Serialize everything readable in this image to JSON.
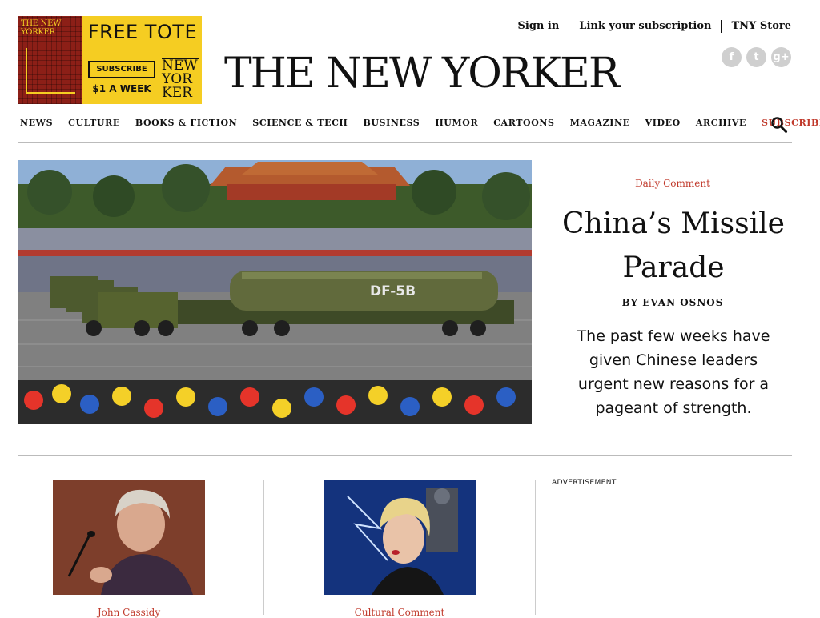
{
  "ad": {
    "cover_title": "THE NEW YORKER",
    "headline": "FREE TOTE",
    "subscribe_label": "SUBSCRIBE",
    "price": "$1 A WEEK",
    "tote_lines": [
      "NEW",
      "YOR",
      "KER"
    ]
  },
  "top_links": [
    "Sign in",
    "Link your subscription",
    "TNY Store"
  ],
  "social": [
    {
      "icon": "facebook-icon",
      "glyph": "f"
    },
    {
      "icon": "twitter-icon",
      "glyph": "t"
    },
    {
      "icon": "google-plus-icon",
      "glyph": "g+"
    }
  ],
  "logo": "THE NEW YORKER",
  "nav": [
    "NEWS",
    "CULTURE",
    "BOOKS & FICTION",
    "SCIENCE & TECH",
    "BUSINESS",
    "HUMOR",
    "CARTOONS",
    "MAGAZINE",
    "VIDEO",
    "ARCHIVE",
    "SUBSCRIBE"
  ],
  "colors": {
    "accent": "#c0392b"
  },
  "hero": {
    "kicker": "Daily Comment",
    "title": "China’s Missile Parade",
    "byline": "BY EVAN OSNOS",
    "dek": "The past few weeks have given Chinese leaders urgent new reasons for a pageant of strength.",
    "image_label": "DF-5B"
  },
  "cards": [
    {
      "kicker": "John Cassidy"
    },
    {
      "kicker": "Cultural Comment"
    }
  ],
  "advertisement_label": "ADVERTISEMENT"
}
